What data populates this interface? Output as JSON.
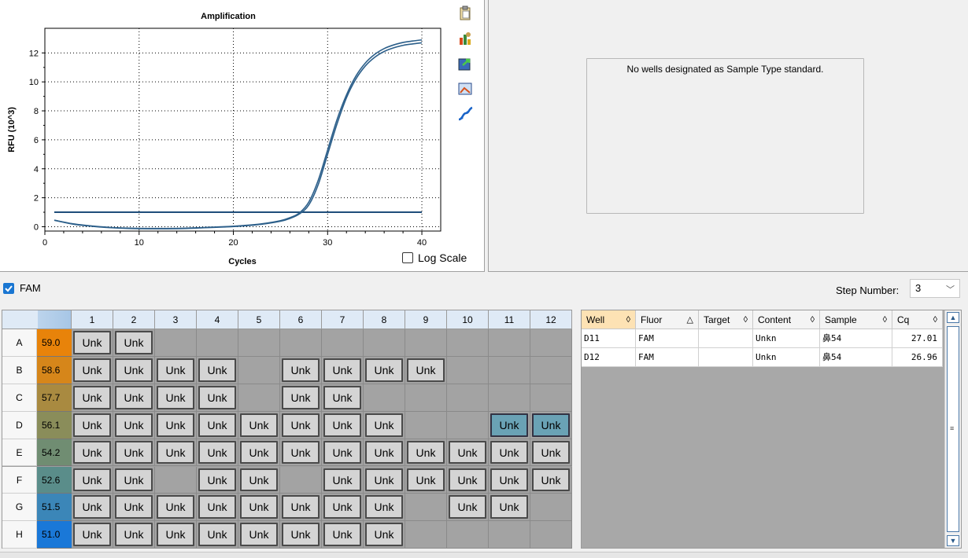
{
  "chart": {
    "toolbar_icons": [
      "copy-icon",
      "chart-settings-icon",
      "export-icon",
      "image-icon",
      "curve-icon"
    ],
    "log_scale_label": "Log Scale"
  },
  "chart_data": {
    "type": "line",
    "title": "Amplification",
    "xlabel": "Cycles",
    "ylabel": "RFU (10^3)",
    "xlim": [
      0,
      42
    ],
    "ylim": [
      -0.3,
      13.7
    ],
    "x_ticks": [
      0,
      10,
      20,
      30,
      40
    ],
    "y_ticks": [
      0,
      2,
      4,
      6,
      8,
      10,
      12
    ],
    "grid": true,
    "log_scale": false,
    "threshold": 1.0,
    "series": [
      {
        "x": [
          1,
          3,
          5,
          7,
          9,
          11,
          13,
          15,
          17,
          19,
          21,
          23,
          25,
          26,
          27,
          28,
          29,
          30,
          31,
          32,
          33,
          34,
          35,
          36,
          37,
          38,
          39,
          40
        ],
        "values": [
          0.45,
          0.2,
          0.05,
          -0.05,
          -0.1,
          -0.12,
          -0.12,
          -0.1,
          -0.05,
          0.0,
          0.08,
          0.2,
          0.42,
          0.62,
          0.95,
          1.7,
          3.2,
          5.3,
          7.4,
          9.1,
          10.4,
          11.3,
          11.9,
          12.3,
          12.55,
          12.72,
          12.82,
          12.9
        ]
      },
      {
        "x": [
          1,
          3,
          5,
          7,
          9,
          11,
          13,
          15,
          17,
          19,
          21,
          23,
          25,
          26,
          27,
          28,
          29,
          30,
          31,
          32,
          33,
          34,
          35,
          36,
          37,
          38,
          39,
          40
        ],
        "values": [
          0.45,
          0.18,
          0.03,
          -0.07,
          -0.12,
          -0.14,
          -0.14,
          -0.12,
          -0.07,
          -0.02,
          0.05,
          0.17,
          0.38,
          0.57,
          0.88,
          1.5,
          2.9,
          5.0,
          7.1,
          8.9,
          10.2,
          11.1,
          11.7,
          12.1,
          12.35,
          12.52,
          12.62,
          12.7
        ]
      }
    ]
  },
  "standard_curve": {
    "message": "No wells designated as Sample Type standard."
  },
  "fluor_bar": {
    "fam_label": "FAM",
    "fam_checked": true,
    "step_label": "Step Number:",
    "step_value": "3"
  },
  "plate": {
    "columns": [
      "1",
      "2",
      "3",
      "4",
      "5",
      "6",
      "7",
      "8",
      "9",
      "10",
      "11",
      "12"
    ],
    "rows": [
      {
        "label": "A",
        "temp": "59.0",
        "color": "#e8830a",
        "wells": [
          "Unk",
          "Unk",
          "",
          "",
          "",
          "",
          "",
          "",
          "",
          "",
          "",
          ""
        ]
      },
      {
        "label": "B",
        "temp": "58.6",
        "color": "#d6861a",
        "wells": [
          "Unk",
          "Unk",
          "Unk",
          "Unk",
          "",
          "Unk",
          "Unk",
          "Unk",
          "Unk",
          "",
          "",
          ""
        ]
      },
      {
        "label": "C",
        "temp": "57.7",
        "color": "#a98a40",
        "wells": [
          "Unk",
          "Unk",
          "Unk",
          "Unk",
          "",
          "Unk",
          "Unk",
          "",
          "",
          "",
          "",
          ""
        ]
      },
      {
        "label": "D",
        "temp": "56.1",
        "color": "#8a8d5a",
        "wells": [
          "Unk",
          "Unk",
          "Unk",
          "Unk",
          "Unk",
          "Unk",
          "Unk",
          "Unk",
          "",
          "",
          "Unk",
          "Unk"
        ]
      },
      {
        "label": "E",
        "temp": "54.2",
        "color": "#708d72",
        "wells": [
          "Unk",
          "Unk",
          "Unk",
          "Unk",
          "Unk",
          "Unk",
          "Unk",
          "Unk",
          "Unk",
          "Unk",
          "Unk",
          "Unk"
        ]
      },
      {
        "label": "F",
        "temp": "52.6",
        "color": "#5a8d8a",
        "wells": [
          "Unk",
          "Unk",
          "",
          "Unk",
          "Unk",
          "",
          "Unk",
          "Unk",
          "Unk",
          "Unk",
          "Unk",
          "Unk"
        ]
      },
      {
        "label": "G",
        "temp": "51.5",
        "color": "#3b86b8",
        "wells": [
          "Unk",
          "Unk",
          "Unk",
          "Unk",
          "Unk",
          "Unk",
          "Unk",
          "Unk",
          "",
          "Unk",
          "Unk",
          ""
        ]
      },
      {
        "label": "H",
        "temp": "51.0",
        "color": "#1a78d8",
        "wells": [
          "Unk",
          "Unk",
          "Unk",
          "Unk",
          "Unk",
          "Unk",
          "Unk",
          "Unk",
          "",
          "",
          "",
          ""
        ]
      }
    ],
    "selected": [
      [
        3,
        10
      ],
      [
        3,
        11
      ]
    ]
  },
  "well_table": {
    "columns": [
      {
        "label": "Well",
        "sort": "◊",
        "active": true
      },
      {
        "label": "Fluor",
        "sort": "△",
        "active": false
      },
      {
        "label": "Target",
        "sort": "◊",
        "active": false
      },
      {
        "label": "Content",
        "sort": "◊",
        "active": false
      },
      {
        "label": "Sample",
        "sort": "◊",
        "active": false
      },
      {
        "label": "Cq",
        "sort": "◊",
        "active": false
      }
    ],
    "rows": [
      [
        "D11",
        "FAM",
        "",
        "Unkn",
        "鼻54",
        "27.01"
      ],
      [
        "D12",
        "FAM",
        "",
        "Unkn",
        "鼻54",
        "26.96"
      ]
    ]
  },
  "scrollbar": {
    "up": "▲",
    "down": "▼",
    "grip": "≡"
  }
}
